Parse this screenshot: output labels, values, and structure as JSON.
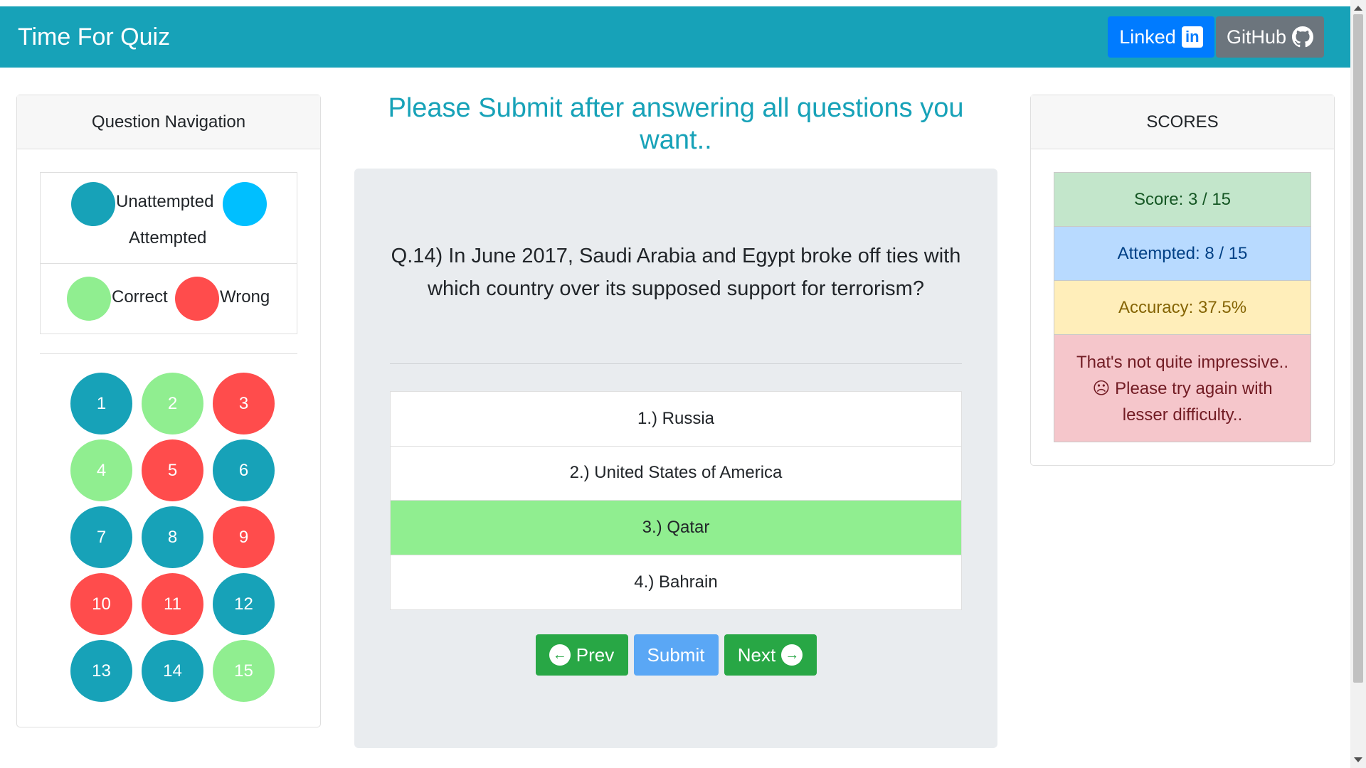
{
  "app": {
    "brand": "Time For Quiz"
  },
  "nav_links": {
    "linked_label": "Linked",
    "linked_icon": "in",
    "github_label": "GitHub"
  },
  "colors": {
    "unattempted": "#17a2b8",
    "attempted": "#00bfff",
    "correct": "#90ee90",
    "wrong": "#ff4c4c",
    "accent": "#17a2b8"
  },
  "question_nav": {
    "header": "Question Navigation",
    "legend": {
      "unattempted": "Unattempted",
      "attempted": "Attempted",
      "correct": "Correct",
      "wrong": "Wrong"
    },
    "questions": [
      {
        "number": "1",
        "status": "unattempted"
      },
      {
        "number": "2",
        "status": "correct"
      },
      {
        "number": "3",
        "status": "wrong"
      },
      {
        "number": "4",
        "status": "correct"
      },
      {
        "number": "5",
        "status": "wrong"
      },
      {
        "number": "6",
        "status": "unattempted"
      },
      {
        "number": "7",
        "status": "unattempted"
      },
      {
        "number": "8",
        "status": "unattempted"
      },
      {
        "number": "9",
        "status": "wrong"
      },
      {
        "number": "10",
        "status": "wrong"
      },
      {
        "number": "11",
        "status": "wrong"
      },
      {
        "number": "12",
        "status": "unattempted"
      },
      {
        "number": "13",
        "status": "unattempted"
      },
      {
        "number": "14",
        "status": "unattempted"
      },
      {
        "number": "15",
        "status": "correct"
      }
    ]
  },
  "main": {
    "headline": "Please Submit after answering all questions you want..",
    "question": "Q.14) In June 2017, Saudi Arabia and Egypt broke off ties with which country over its supposed support for terrorism?",
    "options": [
      {
        "label": "1.) Russia",
        "selected": false
      },
      {
        "label": "2.) United States of America",
        "selected": false
      },
      {
        "label": "3.) Qatar",
        "selected": true
      },
      {
        "label": "4.) Bahrain",
        "selected": false
      }
    ],
    "prev_label": "Prev",
    "submit_label": "Submit",
    "next_label": "Next"
  },
  "scores": {
    "header": "SCORES",
    "score": "Score: 3 / 15",
    "attempted": "Attempted: 8 / 15",
    "accuracy": "Accuracy: 37.5%",
    "message": "That's not quite impressive.. ☹ Please try again with lesser difficulty.."
  }
}
